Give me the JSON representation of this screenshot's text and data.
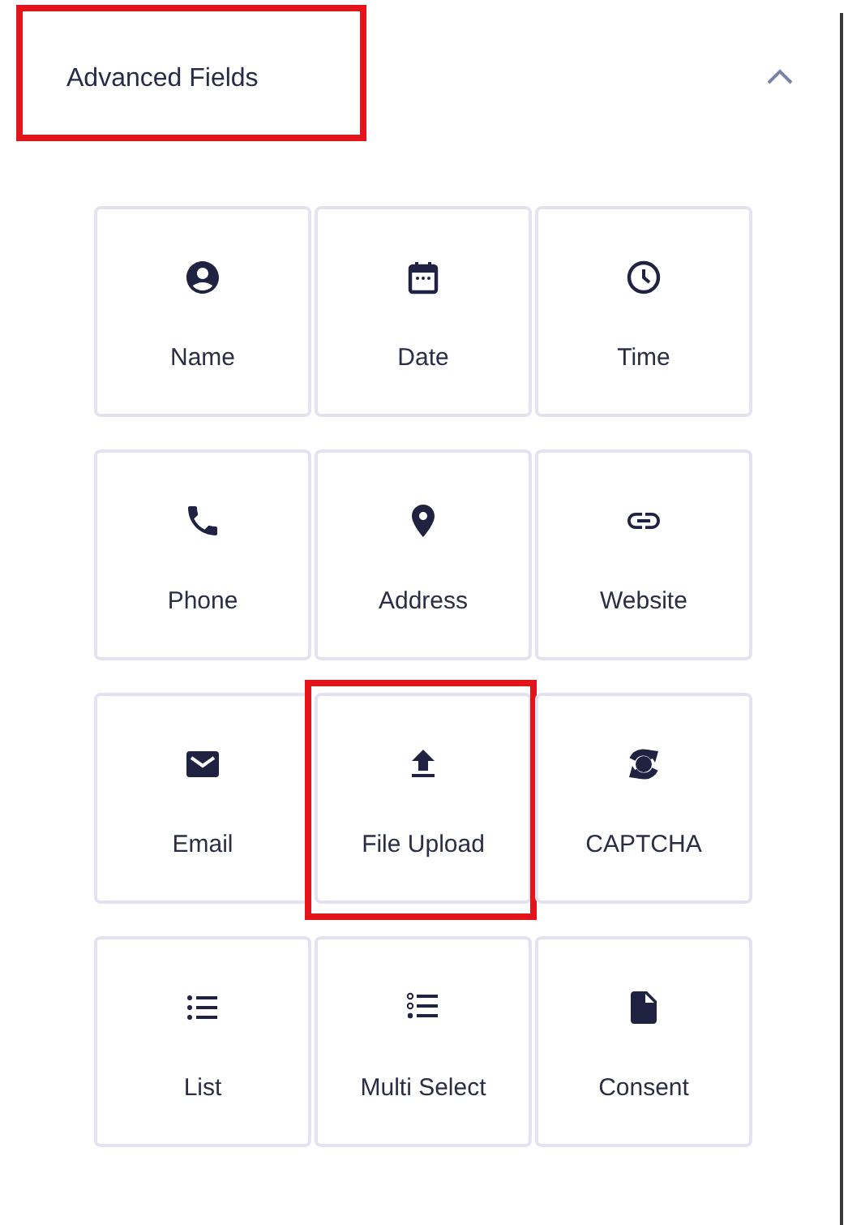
{
  "section": {
    "title": "Advanced Fields",
    "expanded": true,
    "highlighted": true
  },
  "fields": [
    {
      "label": "Name",
      "highlighted": false
    },
    {
      "label": "Date",
      "highlighted": false
    },
    {
      "label": "Time",
      "highlighted": false
    },
    {
      "label": "Phone",
      "highlighted": false
    },
    {
      "label": "Address",
      "highlighted": false
    },
    {
      "label": "Website",
      "highlighted": false
    },
    {
      "label": "Email",
      "highlighted": false
    },
    {
      "label": "File Upload",
      "highlighted": true
    },
    {
      "label": "CAPTCHA",
      "highlighted": false
    },
    {
      "label": "List",
      "highlighted": false
    },
    {
      "label": "Multi Select",
      "highlighted": false
    },
    {
      "label": "Consent",
      "highlighted": false
    }
  ]
}
